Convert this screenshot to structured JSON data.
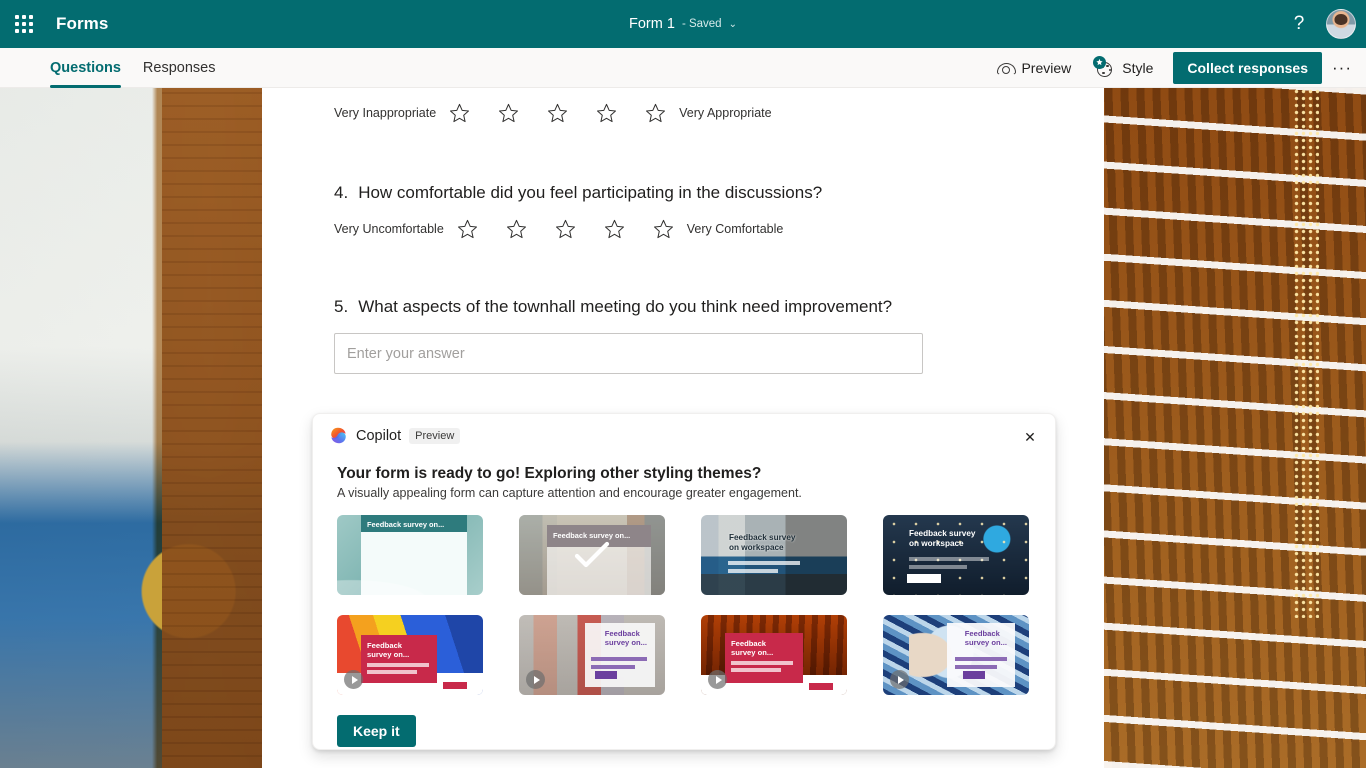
{
  "header": {
    "app_name": "Forms",
    "form_title": "Form 1",
    "saved_text": "- Saved",
    "chevron": "⌄",
    "help_label": "?",
    "waffle_name": "app-launcher",
    "avatar_name": "user-avatar",
    "brand_color": "#036c70"
  },
  "commandbar": {
    "tabs": [
      {
        "label": "Questions",
        "active": true
      },
      {
        "label": "Responses",
        "active": false
      }
    ],
    "preview_label": "Preview",
    "style_label": "Style",
    "collect_label": "Collect responses",
    "more_label": "···"
  },
  "form": {
    "question3": {
      "left_label": "Very Inappropriate",
      "right_label": "Very Appropriate",
      "star_count": 5
    },
    "question4": {
      "number": "4.",
      "text": "How comfortable did you feel participating in the discussions?",
      "left_label": "Very Uncomfortable",
      "right_label": "Very Comfortable",
      "star_count": 5
    },
    "question5": {
      "number": "5.",
      "text": "What aspects of the townhall meeting do you think need improvement?",
      "answer_value": "",
      "answer_placeholder": "Enter your answer"
    }
  },
  "copilot": {
    "name": "Copilot",
    "preview_badge": "Preview",
    "close_label": "✕",
    "heading": "Your form is ready to go! Exploring other styling themes?",
    "subtext": "A visually appealing form can capture attention and encourage greater engagement.",
    "keep_button": "Keep it",
    "themes": [
      {
        "id": "t1",
        "label": "Feedback survey on...",
        "selected": false,
        "video": false
      },
      {
        "id": "t2",
        "label": "Feedback survey on...",
        "selected": true,
        "video": false
      },
      {
        "id": "t3",
        "label": "Feedback survey\non workspace",
        "selected": false,
        "video": false
      },
      {
        "id": "t4",
        "label": "Feedback survey\non workspace",
        "selected": false,
        "video": false
      },
      {
        "id": "t5",
        "label": "Feedback\nsurvey on...",
        "selected": false,
        "video": true
      },
      {
        "id": "t6",
        "label": "Feedback\nsurvey on...",
        "selected": false,
        "video": true
      },
      {
        "id": "t7",
        "label": "Feedback\nsurvey on...",
        "selected": false,
        "video": true
      },
      {
        "id": "t8",
        "label": "Feedback\nsurvey on...",
        "selected": false,
        "video": true
      }
    ]
  }
}
